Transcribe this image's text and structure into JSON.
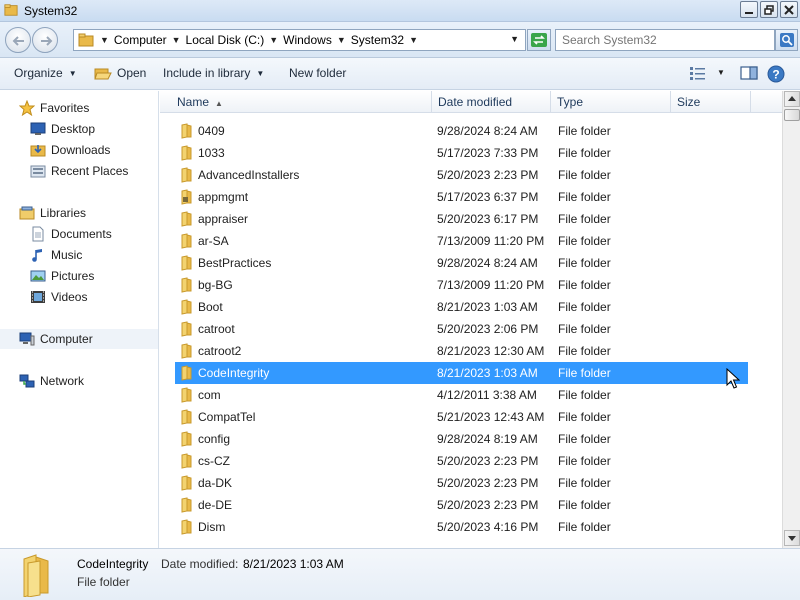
{
  "window": {
    "title": "System32"
  },
  "address": {
    "crumbs": [
      "Computer",
      "Local Disk (C:)",
      "Windows",
      "System32"
    ]
  },
  "search": {
    "placeholder": "Search System32"
  },
  "toolbar": {
    "organize": "Organize",
    "open": "Open",
    "include_in_library": "Include in library",
    "new_folder": "New folder"
  },
  "nav": {
    "favorites": "Favorites",
    "desktop": "Desktop",
    "downloads": "Downloads",
    "recent_places": "Recent Places",
    "libraries": "Libraries",
    "documents": "Documents",
    "music": "Music",
    "pictures": "Pictures",
    "videos": "Videos",
    "computer": "Computer",
    "network": "Network"
  },
  "columns": {
    "name": "Name",
    "date_modified": "Date modified",
    "type": "Type",
    "size": "Size"
  },
  "files": [
    {
      "name": "0409",
      "date": "9/28/2024 8:24 AM",
      "type": "File folder"
    },
    {
      "name": "1033",
      "date": "5/17/2023 7:33 PM",
      "type": "File folder"
    },
    {
      "name": "AdvancedInstallers",
      "date": "5/20/2023 2:23 PM",
      "type": "File folder"
    },
    {
      "name": "appmgmt",
      "date": "5/17/2023 6:37 PM",
      "type": "File folder"
    },
    {
      "name": "appraiser",
      "date": "5/20/2023 6:17 PM",
      "type": "File folder"
    },
    {
      "name": "ar-SA",
      "date": "7/13/2009 11:20 PM",
      "type": "File folder"
    },
    {
      "name": "BestPractices",
      "date": "9/28/2024 8:24 AM",
      "type": "File folder"
    },
    {
      "name": "bg-BG",
      "date": "7/13/2009 11:20 PM",
      "type": "File folder"
    },
    {
      "name": "Boot",
      "date": "8/21/2023 1:03 AM",
      "type": "File folder"
    },
    {
      "name": "catroot",
      "date": "5/20/2023 2:06 PM",
      "type": "File folder"
    },
    {
      "name": "catroot2",
      "date": "8/21/2023 12:30 AM",
      "type": "File folder"
    },
    {
      "name": "CodeIntegrity",
      "date": "8/21/2023 1:03 AM",
      "type": "File folder"
    },
    {
      "name": "com",
      "date": "4/12/2011 3:38 AM",
      "type": "File folder"
    },
    {
      "name": "CompatTel",
      "date": "5/21/2023 12:43 AM",
      "type": "File folder"
    },
    {
      "name": "config",
      "date": "9/28/2024 8:19 AM",
      "type": "File folder"
    },
    {
      "name": "cs-CZ",
      "date": "5/20/2023 2:23 PM",
      "type": "File folder"
    },
    {
      "name": "da-DK",
      "date": "5/20/2023 2:23 PM",
      "type": "File folder"
    },
    {
      "name": "de-DE",
      "date": "5/20/2023 2:23 PM",
      "type": "File folder"
    },
    {
      "name": "Dism",
      "date": "5/20/2023 4:16 PM",
      "type": "File folder"
    }
  ],
  "details": {
    "name": "CodeIntegrity",
    "date_label": "Date modified:",
    "date_value": "8/21/2023 1:03 AM",
    "type": "File folder"
  },
  "colors": {
    "selection": "#3399ff",
    "folder": "#e9b949",
    "header_text": "#1e395b"
  }
}
